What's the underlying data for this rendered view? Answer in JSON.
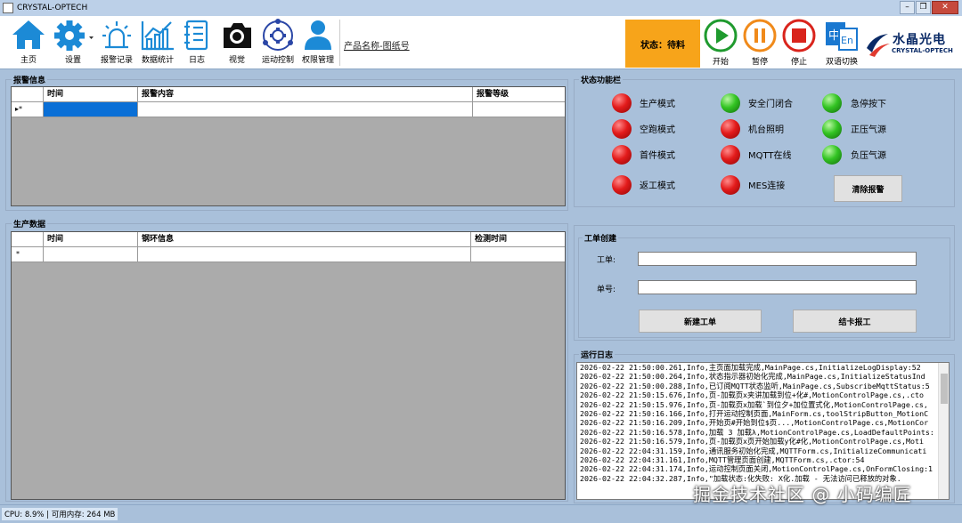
{
  "window": {
    "title": "CRYSTAL-OPTECH"
  },
  "toolbar": {
    "items": [
      {
        "label": "主页",
        "icon": "home-icon"
      },
      {
        "label": "设置",
        "icon": "gear-icon"
      },
      {
        "label": "报警记录",
        "icon": "alarm-icon"
      },
      {
        "label": "数据统计",
        "icon": "chart-icon"
      },
      {
        "label": "日志",
        "icon": "log-icon"
      },
      {
        "label": "视觉",
        "icon": "camera-icon"
      },
      {
        "label": "运动控制",
        "icon": "motion-icon"
      },
      {
        "label": "权限管理",
        "icon": "user-icon"
      }
    ],
    "product_label": "产品名称-图纸号",
    "status_text": "状态：待料",
    "status_color": "#f7a41a",
    "controls": [
      {
        "label": "开始",
        "icon": "play-icon",
        "color": "#1f9a2e"
      },
      {
        "label": "暂停",
        "icon": "pause-icon",
        "color": "#f08a1a"
      },
      {
        "label": "停止",
        "icon": "stop-icon",
        "color": "#d9241c"
      },
      {
        "label": "双语切换",
        "icon": "language-icon",
        "color": "#1a78d0"
      }
    ],
    "brand": {
      "cn": "水晶光电",
      "en": "CRYSTAL-OPTECH"
    }
  },
  "alarm": {
    "title": "报警信息",
    "columns": [
      "时间",
      "报警内容",
      "报警等级"
    ],
    "row_marker": "▸*"
  },
  "production": {
    "title": "生产数据",
    "columns": [
      "时间",
      "钢环信息",
      "检测时间"
    ],
    "row_marker": "*"
  },
  "status_panel": {
    "title": "状态功能栏",
    "indicators": [
      {
        "label": "生产模式",
        "state": "red"
      },
      {
        "label": "安全门闭合",
        "state": "green"
      },
      {
        "label": "急停按下",
        "state": "green"
      },
      {
        "label": "空跑模式",
        "state": "red"
      },
      {
        "label": "机台照明",
        "state": "red"
      },
      {
        "label": "正压气源",
        "state": "green"
      },
      {
        "label": "首件模式",
        "state": "red"
      },
      {
        "label": "MQTT在线",
        "state": "red"
      },
      {
        "label": "负压气源",
        "state": "green"
      },
      {
        "label": "返工模式",
        "state": "red"
      },
      {
        "label": "MES连接",
        "state": "red"
      }
    ],
    "clear_button": "清除报警"
  },
  "workorder": {
    "title": "工单创建",
    "order_label": "工单:",
    "order_value": "",
    "number_label": "单号:",
    "number_value": "",
    "new_button": "新建工单",
    "close_button": "结卡报工"
  },
  "runlog": {
    "title": "运行日志",
    "lines": [
      "2026-02-22 21:50:00.261,Info,主页面加载完成,MainPage.cs,InitializeLogDisplay:52",
      "2026-02-22 21:50:00.264,Info,状态指示器初始化完成,MainPage.cs,InitializeStatusInd",
      "2026-02-22 21:50:00.288,Info,已订阅MQTT状态监听,MainPage.cs,SubscribeMqttStatus:5",
      "2026-02-22 21:50:15.676,Info,页-加载页x夹讲加载到位+化#,MotionControlPage.cs,.cto",
      "2026-02-22 21:50:15.976,Info,页-加载页x加载`到位夕+加位置式化,MotionControlPage.cs,",
      "2026-02-22 21:50:16.166,Info,打开运动控制页面,MainForm.cs,toolStripButton_MotionC",
      "2026-02-22 21:50:16.209,Info,开始页#开始到位$页...,MotionControlPage.cs,MotionCor",
      "2026-02-22 21:50:16.578,Info,加载 3 加载λ,MotionControlPage.cs,LoadDefaultPoints:",
      "2026-02-22 21:50:16.579,Info,页-加载页x页开始加载y化#化,MotionControlPage.cs,Moti",
      "2026-02-22 22:04:31.159,Info,通讯服务初始化完成,MQTTForm.cs,InitializeCommunicati",
      "2026-02-22 22:04:31.161,Info,MQTT管理页面创建,MQTTForm.cs,.ctor:54",
      "2026-02-22 22:04:31.174,Info,运动控制页面关闭,MotionControlPage.cs,OnFormClosing:1",
      "2026-02-22 22:04:32.287,Info,\"加载状态:化失败: X化.加载 - 无法访问已释放的对象."
    ]
  },
  "statusbar": {
    "text": "CPU: 8.9% | 可用内存: 264 MB"
  },
  "watermark": "掘金技术社区 @ 小码编匠"
}
